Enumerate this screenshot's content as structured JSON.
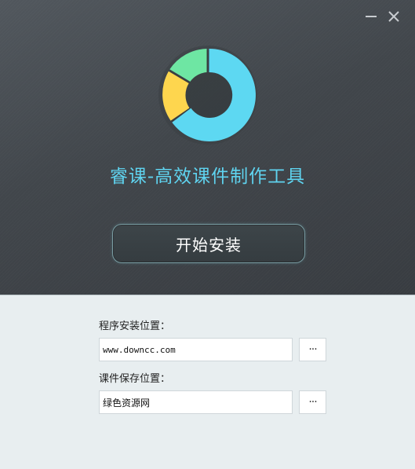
{
  "window": {
    "minimize_icon": "minimize-icon",
    "close_icon": "close-icon"
  },
  "header": {
    "logo_icon": "donut-logo",
    "logo_colors": {
      "blue": "#5dd8f2",
      "yellow": "#fed64e",
      "green": "#6ee6a3"
    },
    "title": "睿课-高效课件制作工具",
    "title_color": "#5fd3ef"
  },
  "actions": {
    "install_label": "开始安装"
  },
  "install_location": {
    "label": "程序安装位置：",
    "value": "www.downcc.com",
    "browse_label": "···"
  },
  "save_location": {
    "label": "课件保存位置：",
    "value": "绿色资源网",
    "browse_label": "···"
  }
}
